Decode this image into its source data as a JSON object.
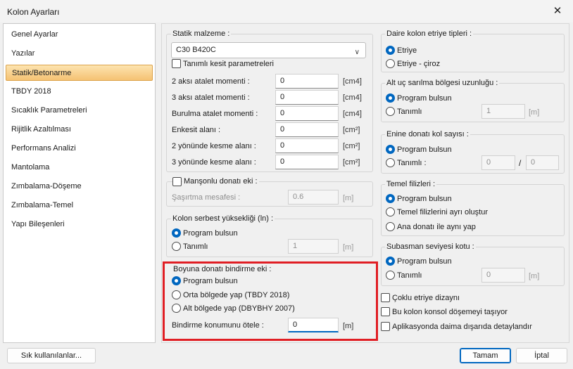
{
  "window": {
    "title": "Kolon Ayarları",
    "close_glyph": "✕"
  },
  "nav": {
    "items": [
      "Genel Ayarlar",
      "Yazılar",
      "Statik/Betonarme",
      "TBDY 2018",
      "Sıcaklık Parametreleri",
      "Rijitlik Azaltılması",
      "Performans Analizi",
      "Mantolama",
      "Zımbalama-Döşeme",
      "Zımbalama-Temel",
      "Yapı Bileşenleri"
    ],
    "active": "Statik/Betonarme"
  },
  "statik": {
    "label": "Statik malzeme :",
    "selected": "C30 B420C",
    "custom_check": "Tanımlı kesit parametreleri",
    "rows": [
      {
        "label": "2 aksı atalet momenti :",
        "value": "0",
        "unit": "[cm4]"
      },
      {
        "label": "3 aksı atalet momenti :",
        "value": "0",
        "unit": "[cm4]"
      },
      {
        "label": "Burulma atalet momenti :",
        "value": "0",
        "unit": "[cm4]"
      },
      {
        "label": "Enkesit alanı :",
        "value": "0",
        "unit": "[cm²]"
      },
      {
        "label": "2 yönünde kesme alanı :",
        "value": "0",
        "unit": "[cm²]"
      },
      {
        "label": "3 yönünde kesme alanı :",
        "value": "0",
        "unit": "[cm²]"
      }
    ]
  },
  "manson": {
    "label": "Manşonlu donatı eki :",
    "field_label": "Şaşırtma mesafesi :",
    "value": "0.6",
    "unit": "[m]"
  },
  "serbest": {
    "label": "Kolon serbest yüksekliği (ln) :",
    "opt1": "Program bulsun",
    "opt2": "Tanımlı",
    "value": "1",
    "unit": "[m]"
  },
  "boyuna": {
    "label": "Boyuna donatı bindirme eki :",
    "opt1": "Program bulsun",
    "opt2": "Orta bölgede yap (TBDY 2018)",
    "opt3": "Alt bölgede yap (DBYBHY 2007)",
    "field_label": "Bindirme konumunu ötele :",
    "value": "0",
    "unit": "[m]"
  },
  "daire": {
    "label": "Daire kolon etriye tipleri :",
    "opt1": "Etriye",
    "opt2": "Etriye - çiroz"
  },
  "altuc": {
    "label": "Alt uç sarılma bölgesi uzunluğu :",
    "opt1": "Program bulsun",
    "opt2": "Tanımlı",
    "value": "1",
    "unit": "[m]"
  },
  "enine": {
    "label": "Enine donatı kol sayısı :",
    "opt1": "Program bulsun",
    "opt2": "Tanımlı :",
    "value1": "0",
    "sep": "/",
    "value2": "0"
  },
  "temel": {
    "label": "Temel filizleri :",
    "opt1": "Program bulsun",
    "opt2": "Temel filizlerini ayrı oluştur",
    "opt3": "Ana donatı ile aynı yap"
  },
  "subasman": {
    "label": "Subasman seviyesi kotu  :",
    "opt1": "Program bulsun",
    "opt2": "Tanımlı",
    "value": "0",
    "unit": "[m]"
  },
  "checks": [
    "Çoklu etriye dizaynı",
    "Bu kolon konsol döşemeyi taşıyor",
    "Aplikasyonda daima dışarıda detaylandır"
  ],
  "footer": {
    "favorites": "Sık kullanılanlar...",
    "ok": "Tamam",
    "cancel": "İptal"
  },
  "colors": {
    "accent": "#0067c0",
    "highlight_box": "#e01e24",
    "nav_active": "#f5c273"
  }
}
